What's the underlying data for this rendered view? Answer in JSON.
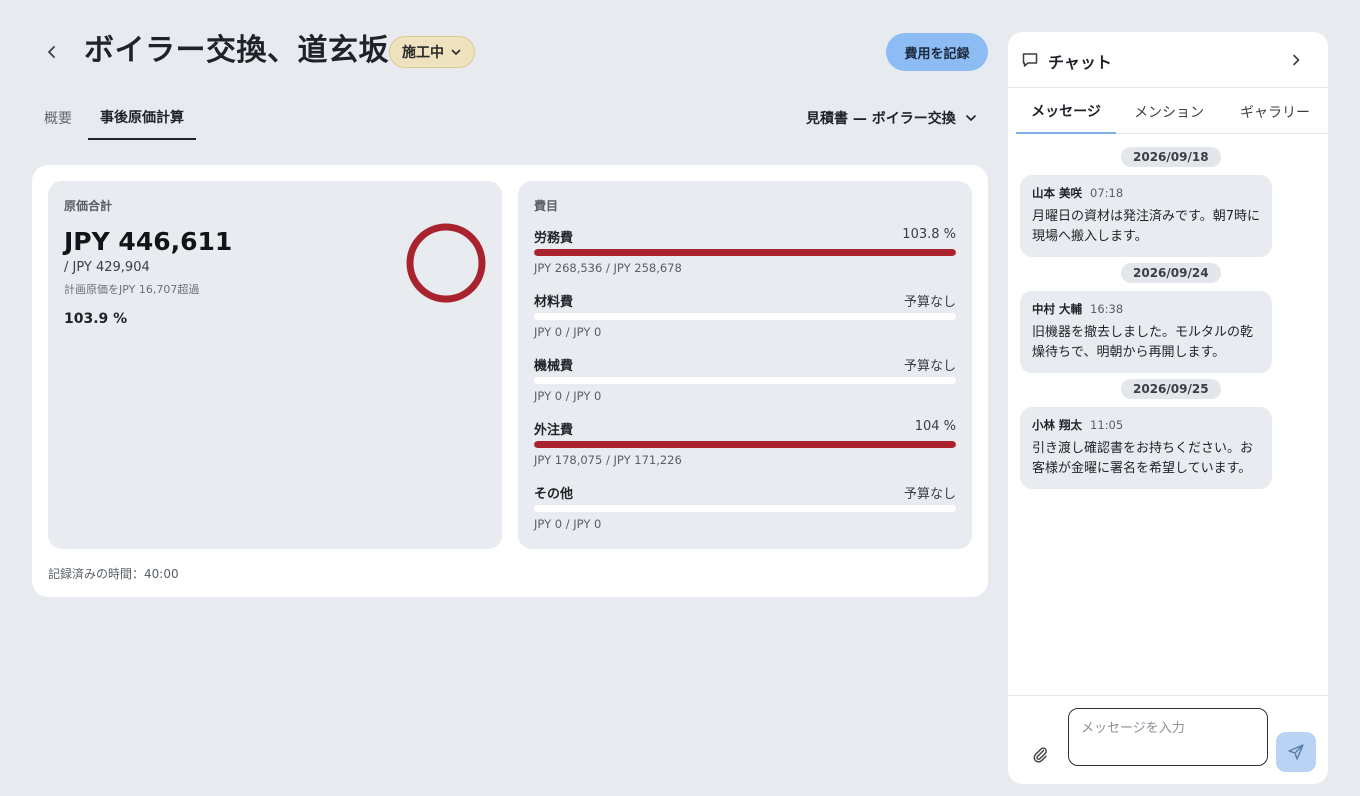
{
  "header": {
    "title": "ボイラー交換、道玄坂",
    "status": "施工中",
    "record_button": "費用を記録"
  },
  "tabs": [
    {
      "label": "概要",
      "active": false
    },
    {
      "label": "事後原価計算",
      "active": true
    }
  ],
  "estimate_selector": "見積書 — ボイラー交換",
  "summary": {
    "label": "原価合計",
    "total": "JPY 446,611",
    "planned": "/ JPY 429,904",
    "over_note": "計画原価をJPY 16,707超過",
    "percent": "103.9 %",
    "percent_value": 103.9
  },
  "categories": {
    "label": "費目",
    "items": [
      {
        "name": "労務費",
        "pct": "103.8 %",
        "fill": 1.0,
        "amounts": "JPY 268,536 / JPY 258,678"
      },
      {
        "name": "材料費",
        "pct": "予算なし",
        "fill": 0,
        "amounts": "JPY 0 / JPY 0"
      },
      {
        "name": "機械費",
        "pct": "予算なし",
        "fill": 0,
        "amounts": "JPY 0 / JPY 0"
      },
      {
        "name": "外注費",
        "pct": "104 %",
        "fill": 1.0,
        "amounts": "JPY 178,075 / JPY 171,226"
      },
      {
        "name": "その他",
        "pct": "予算なし",
        "fill": 0,
        "amounts": "JPY 0 / JPY 0"
      }
    ]
  },
  "recorded_time": "記録済みの時間：40:00",
  "colors": {
    "accent_red": "#a8232d",
    "primary_blue": "#8cbcf3",
    "status_badge": "#efe3bf"
  },
  "chat": {
    "title": "チャット",
    "tabs": [
      {
        "label": "メッセージ",
        "active": true
      },
      {
        "label": "メンション",
        "active": false
      },
      {
        "label": "ギャラリー",
        "active": false
      }
    ],
    "dates": [
      "2026/09/18",
      "2026/09/24",
      "2026/09/25"
    ],
    "messages": [
      {
        "author": "山本 美咲",
        "time": "07:18",
        "text": "月曜日の資材は発注済みです。朝7時に現場へ搬入します。"
      },
      {
        "author": "中村 大輔",
        "time": "16:38",
        "text": "旧機器を撤去しました。モルタルの乾燥待ちで、明朝から再開します。"
      },
      {
        "author": "小林 翔太",
        "time": "11:05",
        "text": "引き渡し確認書をお持ちください。お客様が金曜に署名を希望しています。"
      }
    ],
    "input_placeholder": "メッセージを入力"
  }
}
